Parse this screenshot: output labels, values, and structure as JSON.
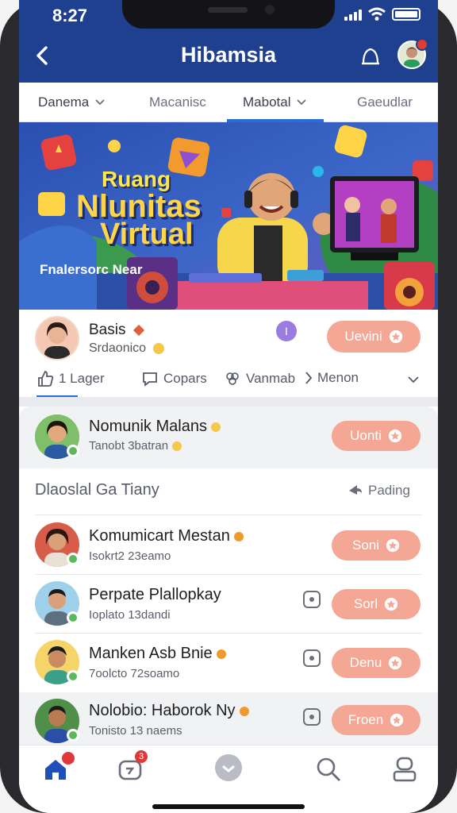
{
  "status": {
    "time": "8:27"
  },
  "header": {
    "title": "Hibamsia"
  },
  "tabs": [
    {
      "label": "Danema"
    },
    {
      "label": "Macanisc"
    },
    {
      "label": "Mabotal"
    },
    {
      "label": "Gaeudlar"
    }
  ],
  "banner": {
    "line1": "Ruang",
    "line2": "Nlunitas",
    "line3": "Virtual",
    "subtitle": "Fnalersorc Near"
  },
  "profile": {
    "name": "Basis",
    "subtitle": "Srdaonico",
    "button": "Uevini",
    "badge": "I"
  },
  "actions": {
    "like": "1 Lager",
    "comment": "Copars",
    "react": "Vanmab",
    "share": "Menon"
  },
  "highlight": {
    "name": "Nomunik Malans",
    "sub": "Tanobt 3batran",
    "button": "Uonti"
  },
  "section": {
    "title": "Dlaoslal Ga Tiany",
    "sort": "Pading"
  },
  "rows": [
    {
      "name": "Komumicart Mestan",
      "sub": "Isokrt2 23eamo",
      "button": "Soni"
    },
    {
      "name": "Perpate Plallopkay",
      "sub": "Ioplato 13dandi",
      "button": "Sorl"
    },
    {
      "name": "Manken Asb Bnie",
      "sub": "7oolcto 72soamo",
      "button": "Denu"
    },
    {
      "name": "Nolobio: Haborok Ny",
      "sub": "Tonisto 13 naems",
      "button": "Froen"
    }
  ],
  "nav": {
    "messages_badge": "3",
    "home_badge": ""
  },
  "colors": {
    "header": "#1f3f8f",
    "accent": "#2b6fd6",
    "pill": "#f5a795",
    "online": "#5cb85c"
  }
}
